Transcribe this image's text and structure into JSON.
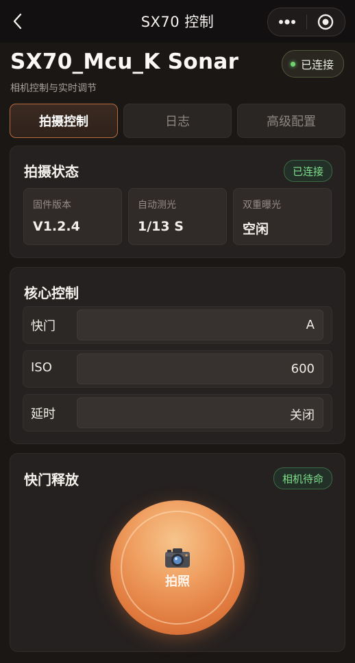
{
  "nav": {
    "title": "SX70 控制"
  },
  "device": {
    "name": "SX70_Mcu_K Sonar",
    "subtitle": "相机控制与实时调节",
    "status": "已连接"
  },
  "tabs": [
    {
      "label": "拍摄控制",
      "active": true
    },
    {
      "label": "日志",
      "active": false
    },
    {
      "label": "高级配置",
      "active": false
    }
  ],
  "status_card": {
    "title": "拍摄状态",
    "badge": "已连接",
    "stats": [
      {
        "label": "固件版本",
        "value": "V1.2.4"
      },
      {
        "label": "自动测光",
        "value": "1/13 S"
      },
      {
        "label": "双重曝光",
        "value": "空闲"
      }
    ]
  },
  "control_card": {
    "title": "核心控制",
    "rows": [
      {
        "label": "快门",
        "value": "A"
      },
      {
        "label": "ISO",
        "value": "600"
      },
      {
        "label": "延时",
        "value": "关闭"
      }
    ]
  },
  "release_card": {
    "title": "快门释放",
    "badge": "相机待命",
    "button_icon": "camera-icon",
    "button_label": "拍照"
  },
  "colors": {
    "accent": "#e07a3e",
    "success": "#7fe08b",
    "background": "#1b1715"
  }
}
